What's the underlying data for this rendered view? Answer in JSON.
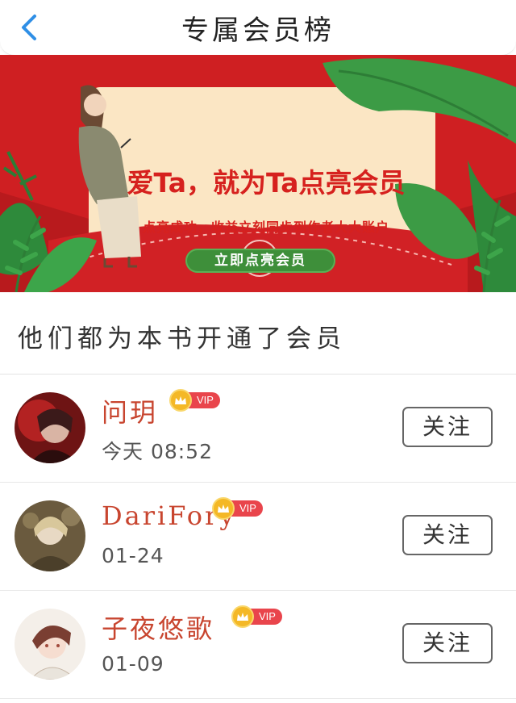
{
  "header": {
    "title": "专属会员榜",
    "back_icon": "chevron-left-icon",
    "accent_color": "#2f8fe6"
  },
  "banner": {
    "title": "爱Ta，就为Ta点亮会员",
    "subtitle": "点亮成功，收益立刻同步到作者大大账户",
    "button_label": "立即点亮会员",
    "background_color": "#cf1f22"
  },
  "section": {
    "title": "他们都为本书开通了会员"
  },
  "members": [
    {
      "name": "问玥",
      "badge": "VIP",
      "time": "今天 08:52",
      "follow_label": "关注"
    },
    {
      "name": "DariFory",
      "badge": "VIP",
      "time": "01-24",
      "follow_label": "关注"
    },
    {
      "name": "子夜悠歌",
      "badge": "VIP",
      "time": "01-09",
      "follow_label": "关注"
    }
  ]
}
